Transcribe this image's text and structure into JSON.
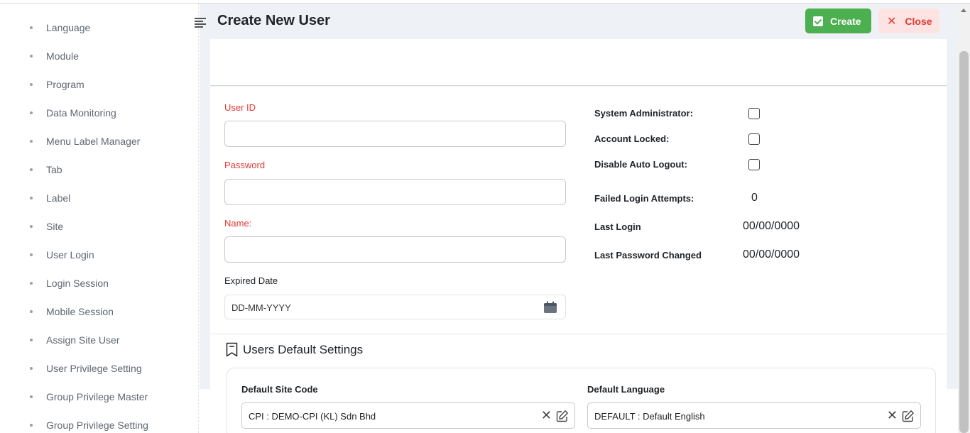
{
  "sidebar": {
    "items": [
      {
        "label": "Language"
      },
      {
        "label": "Module"
      },
      {
        "label": "Program"
      },
      {
        "label": "Data Monitoring"
      },
      {
        "label": "Menu Label Manager"
      },
      {
        "label": "Tab"
      },
      {
        "label": "Label"
      },
      {
        "label": "Site"
      },
      {
        "label": "User Login"
      },
      {
        "label": "Login Session"
      },
      {
        "label": "Mobile Session"
      },
      {
        "label": "Assign Site User"
      },
      {
        "label": "User Privilege Setting"
      },
      {
        "label": "Group Privilege Master"
      },
      {
        "label": "Group Privilege Setting"
      }
    ]
  },
  "header": {
    "title": "Create New User",
    "create_label": "Create",
    "close_label": "Close"
  },
  "form": {
    "user_id_label": "User ID",
    "password_label": "Password",
    "name_label": "Name:",
    "expired_date_label": "Expired Date",
    "expired_date_placeholder": "DD-MM-YYYY"
  },
  "status": {
    "system_admin_label": "System Administrator:",
    "account_locked_label": "Account Locked:",
    "disable_auto_logout_label": "Disable Auto Logout:",
    "failed_login_label": "Failed Login Attempts:",
    "failed_login_value": "0",
    "last_login_label": "Last Login",
    "last_login_value": "00/00/0000",
    "last_password_label": "Last Password Changed",
    "last_password_value": "00/00/0000"
  },
  "defaults": {
    "section_title": "Users Default Settings",
    "site_code_label": "Default Site Code",
    "site_code_value": "CPI : DEMO-CPI (KL) Sdn Bhd",
    "language_label": "Default Language",
    "language_value": "DEFAULT : Default English"
  },
  "colors": {
    "create_button": "#4caf50",
    "close_button_bg": "#fde3e1",
    "close_button_text": "#e53935",
    "required_label": "#e53935"
  },
  "icons": {
    "create": "check-square-icon",
    "close": "close-icon",
    "calendar": "calendar-icon",
    "section": "bookmark-icon",
    "clear": "clear-icon",
    "edit": "edit-icon",
    "menu_toggle": "menu-toggle-icon"
  }
}
